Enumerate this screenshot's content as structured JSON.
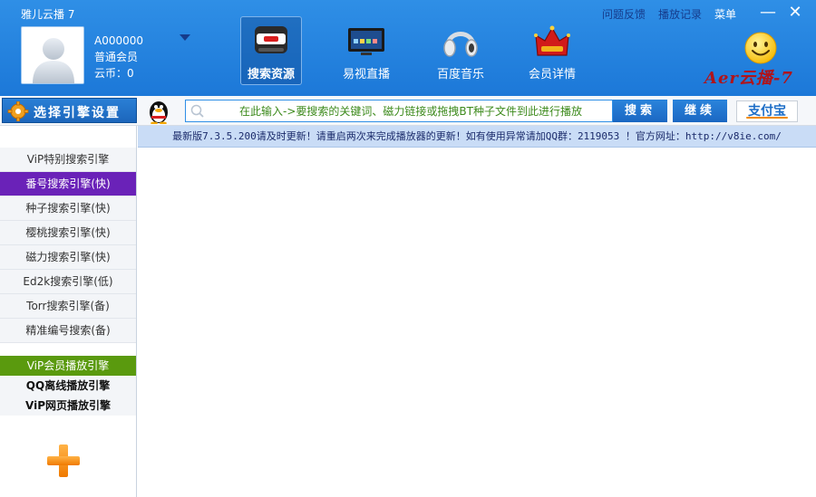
{
  "app": {
    "title": "雅儿云播 7"
  },
  "top_links": {
    "feedback": "问题反馈",
    "history": "播放记录",
    "menu": "菜单"
  },
  "window_controls": {
    "minimize": "—",
    "close": "✕"
  },
  "user": {
    "id": "A000000",
    "level": "普通会员",
    "coins": "云币：0"
  },
  "nav": {
    "search": "搜索资源",
    "live": "易视直播",
    "music": "百度音乐",
    "member": "会员详情"
  },
  "brand": {
    "text": "Aer云播-7"
  },
  "search": {
    "engine_button": "选择引擎设置",
    "placeholder": "在此输入->要搜索的关键词、磁力链接或拖拽BT种子文件到此进行播放",
    "search_button": "搜索",
    "continue_button": "继续",
    "alipay": "支付宝"
  },
  "notice": {
    "text": "最新版7.3.5.200请及时更新！请重启两次来完成播放器的更新！如有使用异常请加QQ群：2119053 ！官方网址：http://v8ie.com/"
  },
  "engines": [
    {
      "label": "ViP特别搜索引擎"
    },
    {
      "label": "番号搜索引擎(快)"
    },
    {
      "label": "种子搜索引擎(快)"
    },
    {
      "label": "樱桃搜索引擎(快)"
    },
    {
      "label": "磁力搜索引擎(快)"
    },
    {
      "label": "Ed2k搜索引擎(低)"
    },
    {
      "label": "Torr搜索引擎(备)"
    },
    {
      "label": "精准编号搜索(备)"
    }
  ],
  "play_engines": [
    {
      "label": "ViP会员播放引擎"
    },
    {
      "label": "QQ离线播放引擎"
    },
    {
      "label": "ViP网页播放引擎"
    }
  ],
  "colors": {
    "topbar": "#1c78d8",
    "active_engine": "#6a22b8",
    "active_play": "#5a9a0e",
    "notice_bg": "#c9dcf6"
  }
}
